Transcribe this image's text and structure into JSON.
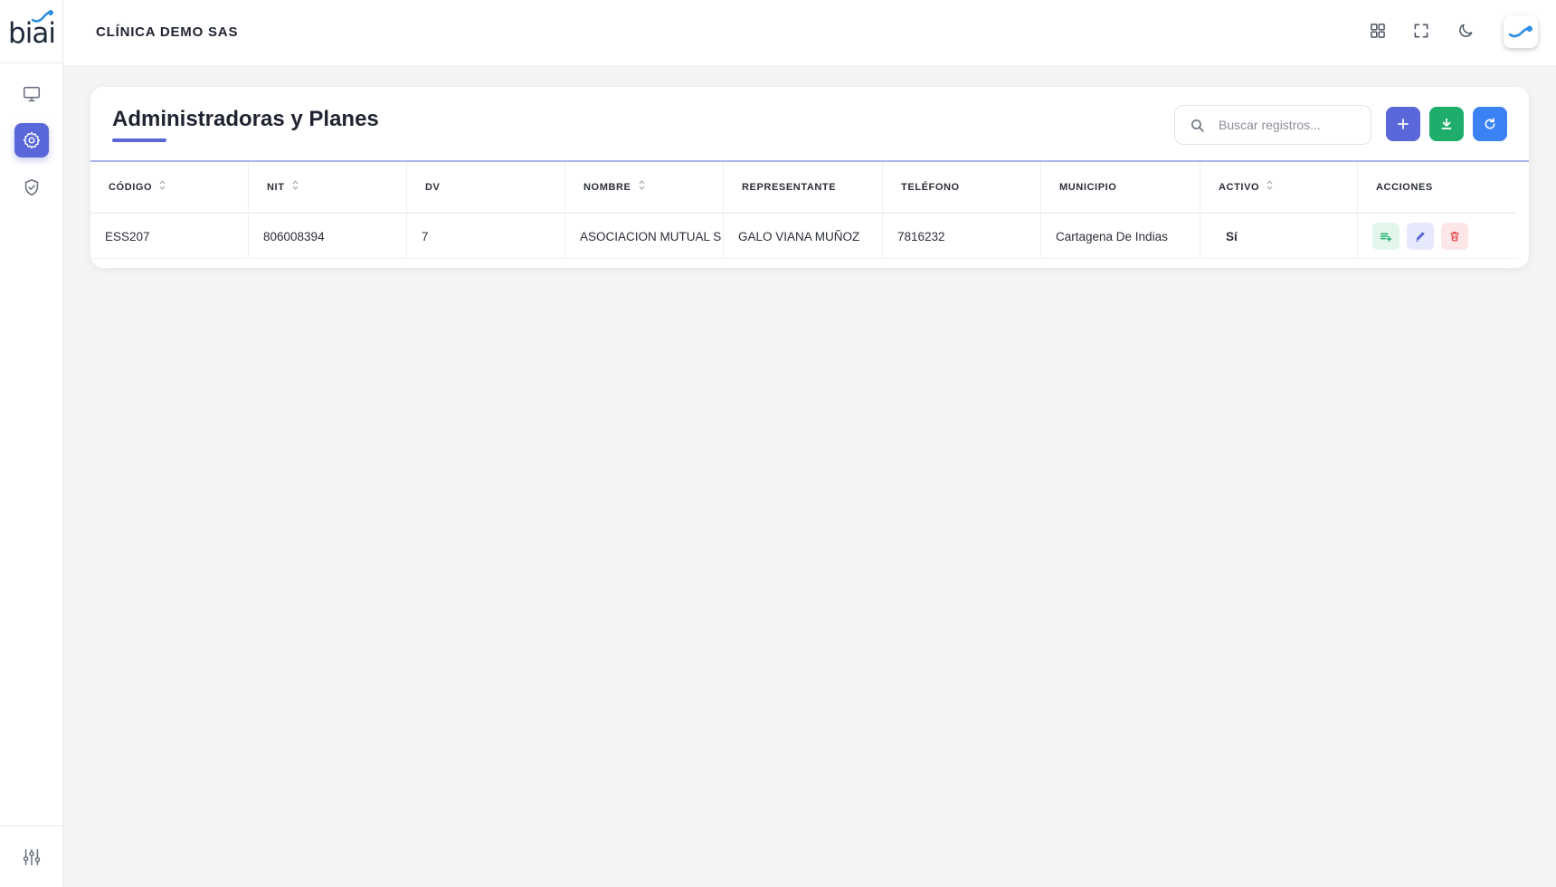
{
  "app": {
    "logo_text": "biai"
  },
  "header": {
    "company": "CLÍNICA DEMO SAS"
  },
  "sidebar": {
    "items": [
      {
        "name": "monitor-icon"
      },
      {
        "name": "gear-icon",
        "active": true
      },
      {
        "name": "shield-check-icon"
      }
    ],
    "bottom": {
      "name": "sliders-icon"
    }
  },
  "page": {
    "title": "Administradoras y Planes",
    "search": {
      "placeholder": "Buscar registros...",
      "value": ""
    },
    "buttons": [
      {
        "name": "add-button",
        "icon": "plus-icon",
        "color": "#5a67d8"
      },
      {
        "name": "download-button",
        "icon": "download-icon",
        "color": "#1fad6c"
      },
      {
        "name": "refresh-button",
        "icon": "refresh-icon",
        "color": "#3b82f6"
      }
    ]
  },
  "table": {
    "columns": [
      {
        "label": "CÓDIGO",
        "sortable": true
      },
      {
        "label": "NIT",
        "sortable": true
      },
      {
        "label": "DV",
        "sortable": false
      },
      {
        "label": "NOMBRE",
        "sortable": true
      },
      {
        "label": "REPRESENTANTE",
        "sortable": false
      },
      {
        "label": "TELÉFONO",
        "sortable": false
      },
      {
        "label": "MUNICIPIO",
        "sortable": false
      },
      {
        "label": "ACTIVO",
        "sortable": true
      },
      {
        "label": "ACCIONES",
        "sortable": false
      }
    ],
    "rows": [
      {
        "codigo": "ESS207",
        "nit": "806008394",
        "dv": "7",
        "nombre": "ASOCIACION MUTUAL S",
        "representante": "GALO VIANA MUÑOZ",
        "telefono": "7816232",
        "municipio": "Cartagena De Indias",
        "activo": "Sí",
        "actions": [
          "add-plan-icon",
          "pencil-icon",
          "trash-icon"
        ]
      }
    ]
  },
  "colors": {
    "accent": "#5a67d8",
    "success": "#1fad6c",
    "info": "#3b82f6",
    "danger": "#e5484d"
  }
}
